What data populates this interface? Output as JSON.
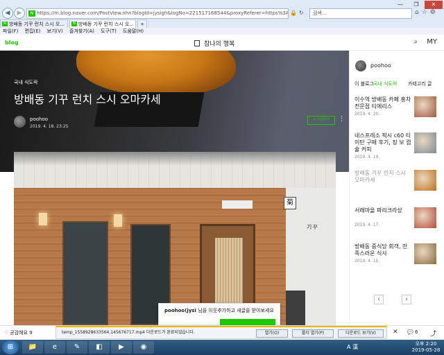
{
  "browser": {
    "address": "https://m.blog.naver.com/PostView.nhn?blogId=jysigh&logNo=221517168544&proxyReferer=https%3A%2F%2Fm.search.daum.net/",
    "search_placeholder": "검색...",
    "tabs": [
      {
        "label": "방배동 기꾸 런치 스시 오..."
      },
      {
        "label": "방배동 기꾸 런치 스시 오..."
      }
    ],
    "menu": [
      "파일(F)",
      "편집(E)",
      "보기(V)",
      "즐겨찾기(A)",
      "도구(T)",
      "도움말(H)"
    ],
    "window_controls": [
      "—",
      "❐",
      "✕"
    ]
  },
  "blog": {
    "logo": "blog",
    "title": "참나의 행복",
    "my": "MY"
  },
  "post": {
    "category": "국내 식도락",
    "title": "방배동 기꾸 런치 스시 오마카세",
    "author": "poohoo",
    "date": "2019. 4. 18. 23:25",
    "neighbor_button": "+ 이웃추가",
    "photo_sign_kiku": "菊",
    "photo_sign_kigu": "기꾸"
  },
  "popup": {
    "author": "poohoo(jysi",
    "message": "님을 이웃추가하고 새글을 받아보세요"
  },
  "sidebar": {
    "author": "poohoo",
    "tabs": [
      "이 블로그",
      "국내 식도락",
      "카테고리 글"
    ],
    "posts": [
      {
        "title": "이수역 방배동 카페 홍차 전문점 티에리스",
        "date": "2019. 4. 20.",
        "thumb": "#a0573a",
        "dim": false
      },
      {
        "title": "네스프레소 픽시 c60 티이탄 구매 후기, 징 보 캡슐 커피",
        "date": "2019. 4. 19.",
        "thumb": "#7c8a92",
        "dim": false
      },
      {
        "title": "방배동 기꾸 런치 스시 오마카세",
        "date": "",
        "thumb": "#c0701a",
        "dim": true
      },
      {
        "title": "서래마을 파리크라상",
        "date": "2019. 4. 17.",
        "thumb": "#b84a3a",
        "dim": false
      },
      {
        "title": "방배동 중식당 회객, 만족스러운 식사",
        "date": "2019. 4. 15.",
        "thumb": "#8a6a3a",
        "dim": false
      }
    ]
  },
  "bottombar": {
    "like_label": "공감해요",
    "like_count": "9",
    "comment_count": "6"
  },
  "download": {
    "message": "temp_1558928633564.145676717.mp4 다운로드가 완료되었습니다.",
    "open": "열기(O)",
    "folder": "폴더 열기(P)",
    "view": "다운로드 보기(V)"
  },
  "taskbar": {
    "lang": "A 漢",
    "time": "오후 2:20",
    "date": "2019-05-28"
  },
  "colors": {
    "brand": "#1ec800"
  }
}
